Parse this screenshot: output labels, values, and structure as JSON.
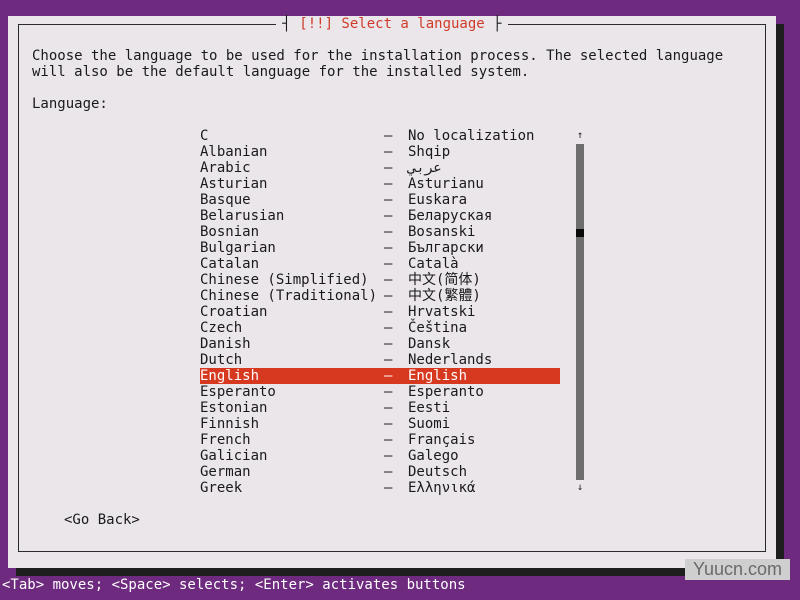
{
  "dialog": {
    "title": "[!!] Select a language",
    "intro": "Choose the language to be used for the installation process. The selected language will also be the default language for the installed system.",
    "label": "Language:",
    "go_back": "<Go Back>"
  },
  "languages": [
    {
      "name": "C",
      "native": "No localization",
      "selected": false
    },
    {
      "name": "Albanian",
      "native": "Shqip",
      "selected": false
    },
    {
      "name": "Arabic",
      "native": "عربي",
      "selected": false
    },
    {
      "name": "Asturian",
      "native": "Asturianu",
      "selected": false
    },
    {
      "name": "Basque",
      "native": "Euskara",
      "selected": false
    },
    {
      "name": "Belarusian",
      "native": "Беларуская",
      "selected": false
    },
    {
      "name": "Bosnian",
      "native": "Bosanski",
      "selected": false
    },
    {
      "name": "Bulgarian",
      "native": "Български",
      "selected": false
    },
    {
      "name": "Catalan",
      "native": "Català",
      "selected": false
    },
    {
      "name": "Chinese (Simplified)",
      "native": "中文(简体)",
      "selected": false
    },
    {
      "name": "Chinese (Traditional)",
      "native": "中文(繁體)",
      "selected": false
    },
    {
      "name": "Croatian",
      "native": "Hrvatski",
      "selected": false
    },
    {
      "name": "Czech",
      "native": "Čeština",
      "selected": false
    },
    {
      "name": "Danish",
      "native": "Dansk",
      "selected": false
    },
    {
      "name": "Dutch",
      "native": "Nederlands",
      "selected": false
    },
    {
      "name": "English",
      "native": "English",
      "selected": true
    },
    {
      "name": "Esperanto",
      "native": "Esperanto",
      "selected": false
    },
    {
      "name": "Estonian",
      "native": "Eesti",
      "selected": false
    },
    {
      "name": "Finnish",
      "native": "Suomi",
      "selected": false
    },
    {
      "name": "French",
      "native": "Français",
      "selected": false
    },
    {
      "name": "Galician",
      "native": "Galego",
      "selected": false
    },
    {
      "name": "German",
      "native": "Deutsch",
      "selected": false
    },
    {
      "name": "Greek",
      "native": "Ελληνικά",
      "selected": false
    }
  ],
  "list_separator": "–",
  "scroll": {
    "up_arrow": "↑",
    "down_arrow": "↓",
    "position_fraction": 0.26
  },
  "statusbar": {
    "text": "<Tab> moves; <Space> selects; <Enter> activates buttons"
  },
  "watermark": "Yuucn.com",
  "colors": {
    "background": "#6e2a7e",
    "dialog": "#eae6ea",
    "accent": "#d6391f",
    "title": "#d03a2a"
  }
}
